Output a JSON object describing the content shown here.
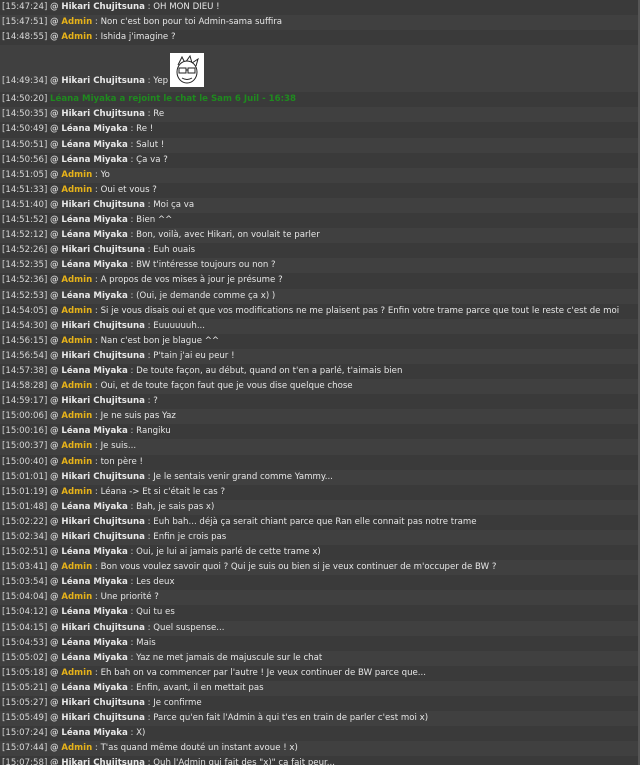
{
  "colors": {
    "admin": "#e6b21a",
    "normal_user": "#e8e8e8",
    "system": "#1f8a1f",
    "background": "#3a3a3a"
  },
  "messages": [
    {
      "time": "[15:47:24]",
      "user": "Hikari Chujitsuna",
      "role": "normal",
      "text": "OH MON DIEU !"
    },
    {
      "time": "[15:47:51]",
      "user": "Admin",
      "role": "admin",
      "text": "Non c'est bon pour toi Admin-sama suffira"
    },
    {
      "time": "[14:48:55]",
      "user": "Admin",
      "role": "admin",
      "text": "Ishida j'imagine ?"
    },
    {
      "time": "[14:49:34]",
      "user": "Hikari Chujitsuna",
      "role": "normal",
      "text": "Yep",
      "emote": "cartoon-face-emote"
    },
    {
      "time": "[14:50:20]",
      "user": "",
      "role": "system",
      "text": "Léana Miyaka a rejoint le chat le Sam 6 Juil - 16:38"
    },
    {
      "time": "[14:50:35]",
      "user": "Hikari Chujitsuna",
      "role": "normal",
      "text": "Re"
    },
    {
      "time": "[14:50:49]",
      "user": "Léana Miyaka",
      "role": "normal",
      "text": "Re !"
    },
    {
      "time": "[14:50:51]",
      "user": "Léana Miyaka",
      "role": "normal",
      "text": "Salut !"
    },
    {
      "time": "[14:50:56]",
      "user": "Léana Miyaka",
      "role": "normal",
      "text": "Ça va ?"
    },
    {
      "time": "[14:51:05]",
      "user": "Admin",
      "role": "admin",
      "text": "Yo"
    },
    {
      "time": "[14:51:33]",
      "user": "Admin",
      "role": "admin",
      "text": "Oui et vous ?"
    },
    {
      "time": "[14:51:40]",
      "user": "Hikari Chujitsuna",
      "role": "normal",
      "text": "Moi ça va"
    },
    {
      "time": "[14:51:52]",
      "user": "Léana Miyaka",
      "role": "normal",
      "text": "Bien ^^"
    },
    {
      "time": "[14:52:12]",
      "user": "Léana Miyaka",
      "role": "normal",
      "text": "Bon, voilà, avec Hikari, on voulait te parler"
    },
    {
      "time": "[14:52:26]",
      "user": "Hikari Chujitsuna",
      "role": "normal",
      "text": "Euh ouais"
    },
    {
      "time": "[14:52:35]",
      "user": "Léana Miyaka",
      "role": "normal",
      "text": "BW t'intéresse toujours ou non ?"
    },
    {
      "time": "[14:52:36]",
      "user": "Admin",
      "role": "admin",
      "text": "A propos de vos mises à jour je présume ?"
    },
    {
      "time": "[14:52:53]",
      "user": "Léana Miyaka",
      "role": "normal",
      "text": "(Oui, je demande comme ça x) )"
    },
    {
      "time": "[14:54:05]",
      "user": "Admin",
      "role": "admin",
      "text": "Si je vous disais oui et que vos modifications ne me plaisent pas ? Enfin votre trame parce que tout le reste c'est de moi"
    },
    {
      "time": "[14:54:30]",
      "user": "Hikari Chujitsuna",
      "role": "normal",
      "text": "Euuuuuuh..."
    },
    {
      "time": "[14:56:15]",
      "user": "Admin",
      "role": "admin",
      "text": "Nan c'est bon je blague ^^"
    },
    {
      "time": "[14:56:54]",
      "user": "Hikari Chujitsuna",
      "role": "normal",
      "text": "P'tain j'ai eu peur !"
    },
    {
      "time": "[14:57:38]",
      "user": "Léana Miyaka",
      "role": "normal",
      "text": "De toute façon, au début, quand on t'en a parlé, t'aimais bien"
    },
    {
      "time": "[14:58:28]",
      "user": "Admin",
      "role": "admin",
      "text": "Oui, et de toute façon faut que je vous dise quelque chose"
    },
    {
      "time": "[14:59:17]",
      "user": "Hikari Chujitsuna",
      "role": "normal",
      "text": "?"
    },
    {
      "time": "[15:00:06]",
      "user": "Admin",
      "role": "admin",
      "text": "Je ne suis pas Yaz"
    },
    {
      "time": "[15:00:16]",
      "user": "Léana Miyaka",
      "role": "normal",
      "text": "Rangiku"
    },
    {
      "time": "[15:00:37]",
      "user": "Admin",
      "role": "admin",
      "text": "Je suis..."
    },
    {
      "time": "[15:00:40]",
      "user": "Admin",
      "role": "admin",
      "text": "ton père !"
    },
    {
      "time": "[15:01:01]",
      "user": "Hikari Chujitsuna",
      "role": "normal",
      "text": "Je le sentais venir grand comme Yammy..."
    },
    {
      "time": "[15:01:19]",
      "user": "Admin",
      "role": "admin",
      "text": "Léana -> Et si c'était le cas ?"
    },
    {
      "time": "[15:01:48]",
      "user": "Léana Miyaka",
      "role": "normal",
      "text": "Bah, je sais pas x)"
    },
    {
      "time": "[15:02:22]",
      "user": "Hikari Chujitsuna",
      "role": "normal",
      "text": "Euh bah... déjà ça serait chiant parce que Ran elle connait pas notre trame"
    },
    {
      "time": "[15:02:34]",
      "user": "Hikari Chujitsuna",
      "role": "normal",
      "text": "Enfin je crois pas"
    },
    {
      "time": "[15:02:51]",
      "user": "Léana Miyaka",
      "role": "normal",
      "text": "Oui, je lui ai jamais parlé de cette trame x)"
    },
    {
      "time": "[15:03:41]",
      "user": "Admin",
      "role": "admin",
      "text": "Bon vous voulez savoir quoi ? Qui je suis ou bien si je veux continuer de m'occuper de BW ?"
    },
    {
      "time": "[15:03:54]",
      "user": "Léana Miyaka",
      "role": "normal",
      "text": "Les deux"
    },
    {
      "time": "[15:04:04]",
      "user": "Admin",
      "role": "admin",
      "text": "Une priorité ?"
    },
    {
      "time": "[15:04:12]",
      "user": "Léana Miyaka",
      "role": "normal",
      "text": "Qui tu es"
    },
    {
      "time": "[15:04:15]",
      "user": "Hikari Chujitsuna",
      "role": "normal",
      "text": "Quel suspense..."
    },
    {
      "time": "[15:04:53]",
      "user": "Léana Miyaka",
      "role": "normal",
      "text": "Mais"
    },
    {
      "time": "[15:05:02]",
      "user": "Léana Miyaka",
      "role": "normal",
      "text": "Yaz ne met jamais de majuscule sur le chat"
    },
    {
      "time": "[15:05:18]",
      "user": "Admin",
      "role": "admin",
      "text": "Eh bah on va commencer par l'autre ! Je veux continuer de BW parce que..."
    },
    {
      "time": "[15:05:21]",
      "user": "Léana Miyaka",
      "role": "normal",
      "text": "Enfin, avant, il en mettait pas"
    },
    {
      "time": "[15:05:27]",
      "user": "Hikari Chujitsuna",
      "role": "normal",
      "text": "Je confirme"
    },
    {
      "time": "[15:05:49]",
      "user": "Hikari Chujitsuna",
      "role": "normal",
      "text": "Parce qu'en fait l'Admin à qui t'es en train de parler c'est moi x)"
    },
    {
      "time": "[15:07:24]",
      "user": "Léana Miyaka",
      "role": "normal",
      "text": "X)"
    },
    {
      "time": "[15:07:44]",
      "user": "Admin",
      "role": "admin",
      "text": "T'as quand même douté un instant avoue ! x)"
    },
    {
      "time": "[15:07:58]",
      "user": "Hikari Chujitsuna",
      "role": "normal",
      "text": "Ouh l'Admin qui fait des \"x)\" ça fait peur..."
    }
  ]
}
